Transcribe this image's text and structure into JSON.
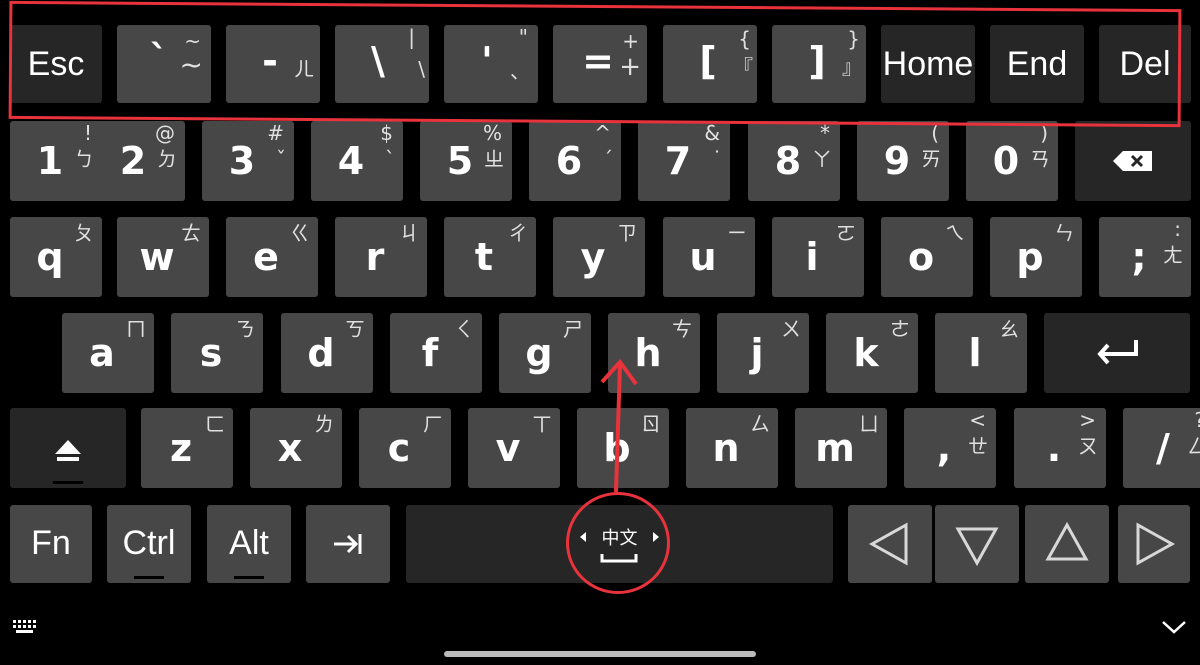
{
  "top_row": [
    {
      "main": "Esc",
      "type": "word"
    },
    {
      "main": "`",
      "sec1": "~",
      "sec2": "~"
    },
    {
      "main": "-",
      "sec1": "",
      "sec2": "ㄦ"
    },
    {
      "main": "\\",
      "sec1": "|",
      "sec2": "\\"
    },
    {
      "main": "'",
      "sec1": "\"",
      "sec2": "、"
    },
    {
      "main": "=",
      "sec1": "+",
      "sec2": "+"
    },
    {
      "main": "[",
      "sec1": "{",
      "sec2": "『"
    },
    {
      "main": "]",
      "sec1": "}",
      "sec2": "』"
    },
    {
      "main": "Home",
      "type": "word"
    },
    {
      "main": "End",
      "type": "word"
    },
    {
      "main": "Del",
      "type": "word"
    }
  ],
  "number_row": [
    {
      "main": "1",
      "sup": "!",
      "sec": "ㄅ"
    },
    {
      "main": "2",
      "sup": "@",
      "sec": "ㄉ"
    },
    {
      "main": "3",
      "sup": "#",
      "sec": "ˇ"
    },
    {
      "main": "4",
      "sup": "$",
      "sec": "ˋ"
    },
    {
      "main": "5",
      "sup": "%",
      "sec": "ㄓ"
    },
    {
      "main": "6",
      "sup": "^",
      "sec": "ˊ"
    },
    {
      "main": "7",
      "sup": "&",
      "sec": "˙"
    },
    {
      "main": "8",
      "sup": "*",
      "sec": "ㄚ"
    },
    {
      "main": "9",
      "sup": "(",
      "sec": "ㄞ"
    },
    {
      "main": "0",
      "sup": ")",
      "sec": "ㄢ"
    }
  ],
  "row_q": [
    {
      "main": "q",
      "sec": "ㄆ"
    },
    {
      "main": "w",
      "sec": "ㄊ"
    },
    {
      "main": "e",
      "sec": "ㄍ"
    },
    {
      "main": "r",
      "sec": "ㄐ"
    },
    {
      "main": "t",
      "sec": "ㄔ"
    },
    {
      "main": "y",
      "sec": "ㄗ"
    },
    {
      "main": "u",
      "sec": "ㄧ"
    },
    {
      "main": "i",
      "sec": "ㄛ"
    },
    {
      "main": "o",
      "sec": "ㄟ"
    },
    {
      "main": "p",
      "sec": "ㄣ"
    },
    {
      "main": ";",
      "sec": "ㄤ",
      "sup": ":"
    }
  ],
  "row_a": [
    {
      "main": "a",
      "sec": "ㄇ"
    },
    {
      "main": "s",
      "sec": "ㄋ"
    },
    {
      "main": "d",
      "sec": "ㄎ"
    },
    {
      "main": "f",
      "sec": "ㄑ"
    },
    {
      "main": "g",
      "sec": "ㄕ"
    },
    {
      "main": "h",
      "sec": "ㄘ"
    },
    {
      "main": "j",
      "sec": "ㄨ"
    },
    {
      "main": "k",
      "sec": "ㄜ"
    },
    {
      "main": "l",
      "sec": "ㄠ"
    }
  ],
  "row_z": [
    {
      "main": "z",
      "sec": "ㄈ"
    },
    {
      "main": "x",
      "sec": "ㄌ"
    },
    {
      "main": "c",
      "sec": "ㄏ"
    },
    {
      "main": "v",
      "sec": "ㄒ"
    },
    {
      "main": "b",
      "sec": "ㄖ"
    },
    {
      "main": "n",
      "sec": "ㄙ"
    },
    {
      "main": "m",
      "sec": "ㄩ"
    },
    {
      "main": ",",
      "sup": "<",
      "sec": "ㄝ"
    },
    {
      "main": ".",
      "sup": ">",
      "sec": "ㄡ"
    },
    {
      "main": "/",
      "sup": "?",
      "sec": "ㄥ"
    }
  ],
  "bottom_row": {
    "fn": "Fn",
    "ctrl": "Ctrl",
    "alt": "Alt",
    "space_label": "中文"
  },
  "icons": {
    "backspace": "backspace-icon",
    "enter": "enter-icon",
    "shift": "shift-icon",
    "tab": "tab-icon",
    "left": "arrow-left-icon",
    "down": "arrow-down-icon",
    "up": "arrow-up-icon",
    "right": "arrow-right-icon",
    "keyboard": "keyboard-icon",
    "collapse": "chevron-down-icon"
  },
  "colors": {
    "key": "#474747",
    "key_dark": "#262626",
    "background": "#000000",
    "annotation": "#e8323c"
  }
}
